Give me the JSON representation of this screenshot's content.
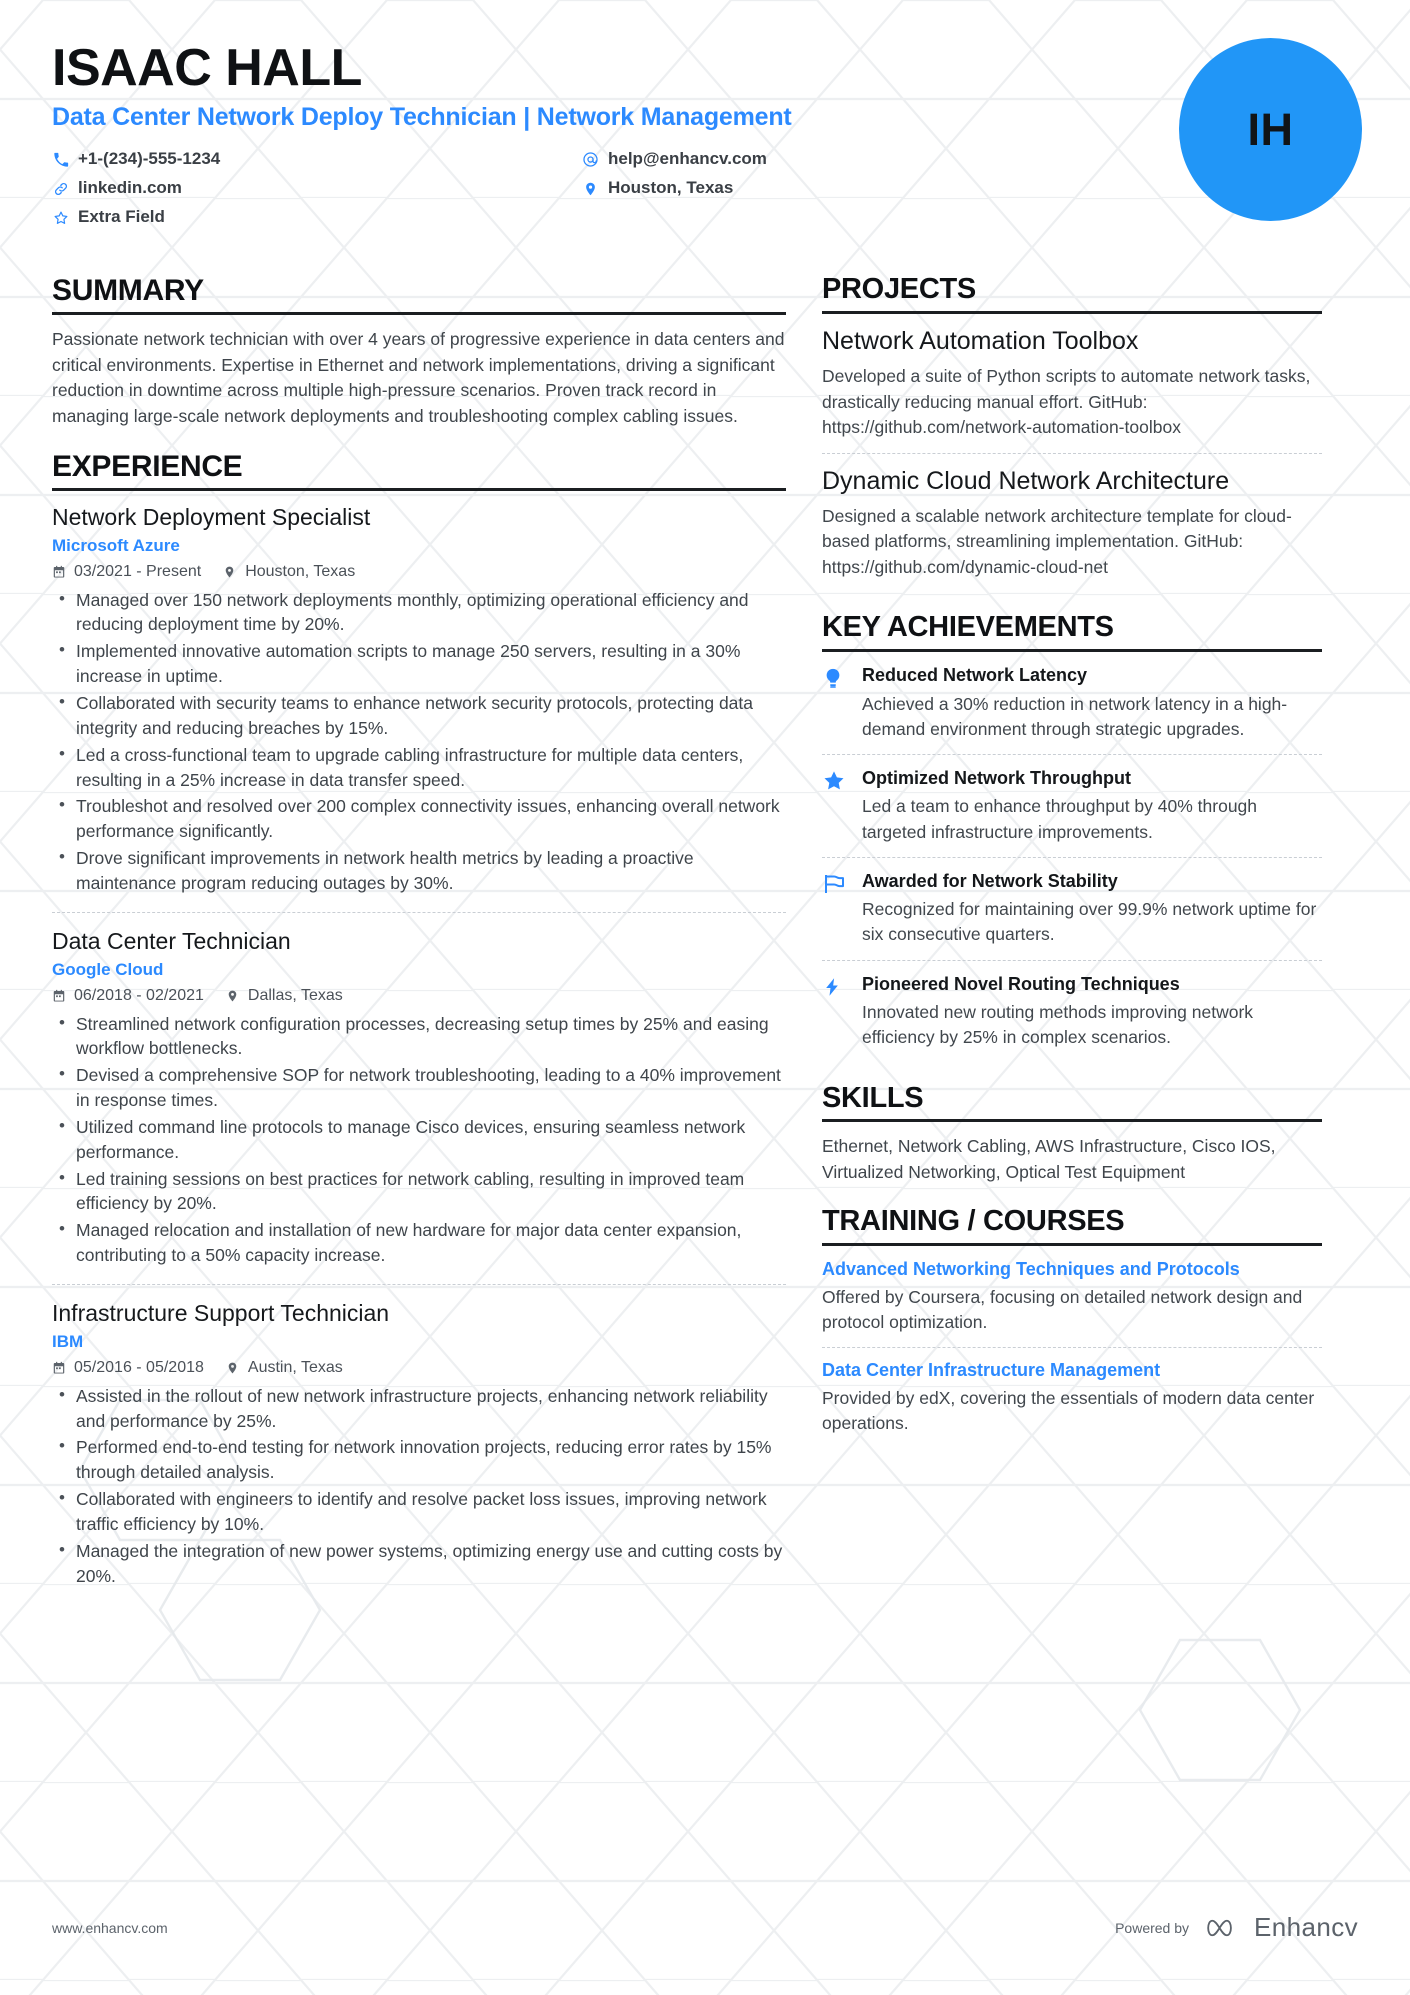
{
  "header": {
    "name": "ISAAC HALL",
    "headline": "Data Center Network Deploy Technician | Network Management",
    "avatar_initials": "IH",
    "accent_color": "#2c8aff",
    "avatar_color": "#2196f7",
    "contacts": [
      {
        "icon": "phone-icon",
        "text": "+1-(234)-555-1234"
      },
      {
        "icon": "email-icon",
        "text": "help@enhancv.com"
      },
      {
        "icon": "link-icon",
        "text": "linkedin.com"
      },
      {
        "icon": "location-pin-icon",
        "text": "Houston, Texas"
      },
      {
        "icon": "star-icon",
        "text": "Extra Field"
      }
    ]
  },
  "summary": {
    "title": "SUMMARY",
    "text": "Passionate network technician with over 4 years of progressive experience in data centers and critical environments. Expertise in Ethernet and network implementations, driving a significant reduction in downtime across multiple high-pressure scenarios. Proven track record in managing large-scale network deployments and troubleshooting complex cabling issues."
  },
  "experience": {
    "title": "EXPERIENCE",
    "entries": [
      {
        "role": "Network Deployment Specialist",
        "company": "Microsoft Azure",
        "dates": "03/2021 - Present",
        "location": "Houston, Texas",
        "bullets": [
          "Managed over 150 network deployments monthly, optimizing operational efficiency and reducing deployment time by 20%.",
          "Implemented innovative automation scripts to manage 250 servers, resulting in a 30% increase in uptime.",
          "Collaborated with security teams to enhance network security protocols, protecting data integrity and reducing breaches by 15%.",
          "Led a cross-functional team to upgrade cabling infrastructure for multiple data centers, resulting in a 25% increase in data transfer speed.",
          "Troubleshot and resolved over 200 complex connectivity issues, enhancing overall network performance significantly.",
          "Drove significant improvements in network health metrics by leading a proactive maintenance program reducing outages by 30%."
        ]
      },
      {
        "role": "Data Center Technician",
        "company": "Google Cloud",
        "dates": "06/2018 - 02/2021",
        "location": "Dallas, Texas",
        "bullets": [
          "Streamlined network configuration processes, decreasing setup times by 25% and easing workflow bottlenecks.",
          "Devised a comprehensive SOP for network troubleshooting, leading to a 40% improvement in response times.",
          "Utilized command line protocols to manage Cisco devices, ensuring seamless network performance.",
          "Led training sessions on best practices for network cabling, resulting in improved team efficiency by 20%.",
          "Managed relocation and installation of new hardware for major data center expansion, contributing to a 50% capacity increase."
        ]
      },
      {
        "role": "Infrastructure Support Technician",
        "company": "IBM",
        "dates": "05/2016 - 05/2018",
        "location": "Austin, Texas",
        "bullets": [
          "Assisted in the rollout of new network infrastructure projects, enhancing network reliability and performance by 25%.",
          "Performed end-to-end testing for network innovation projects, reducing error rates by 15% through detailed analysis.",
          "Collaborated with engineers to identify and resolve packet loss issues, improving network traffic efficiency by 10%.",
          "Managed the integration of new power systems, optimizing energy use and cutting costs by 20%."
        ]
      }
    ]
  },
  "projects": {
    "title": "PROJECTS",
    "entries": [
      {
        "title": "Network Automation Toolbox",
        "description": "Developed a suite of Python scripts to automate network tasks, drastically reducing manual effort. GitHub: https://github.com/network-automation-toolbox"
      },
      {
        "title": "Dynamic Cloud Network Architecture",
        "description": "Designed a scalable network architecture template for cloud-based platforms, streamlining implementation. GitHub: https://github.com/dynamic-cloud-net"
      }
    ]
  },
  "key_achievements": {
    "title": "KEY ACHIEVEMENTS",
    "entries": [
      {
        "icon": "lightbulb-icon",
        "title": "Reduced Network Latency",
        "description": "Achieved a 30% reduction in network latency in a high-demand environment through strategic upgrades."
      },
      {
        "icon": "star-icon",
        "title": "Optimized Network Throughput",
        "description": "Led a team to enhance throughput by 40% through targeted infrastructure improvements."
      },
      {
        "icon": "flag-icon",
        "title": "Awarded for Network Stability",
        "description": "Recognized for maintaining over 99.9% network uptime for six consecutive quarters."
      },
      {
        "icon": "lightning-bolt-icon",
        "title": "Pioneered Novel Routing Techniques",
        "description": "Innovated new routing methods improving network efficiency by 25% in complex scenarios."
      }
    ]
  },
  "skills": {
    "title": "SKILLS",
    "text": "Ethernet, Network Cabling, AWS Infrastructure, Cisco IOS, Virtualized Networking, Optical Test Equipment"
  },
  "training": {
    "title": "TRAINING / COURSES",
    "entries": [
      {
        "title": "Advanced Networking Techniques and Protocols",
        "description": "Offered by Coursera, focusing on detailed network design and protocol optimization."
      },
      {
        "title": "Data Center Infrastructure Management",
        "description": "Provided by edX, covering the essentials of modern data center operations."
      }
    ]
  },
  "footer": {
    "url": "www.enhancv.com",
    "powered_by": "Powered by",
    "brand": "Enhancv"
  }
}
